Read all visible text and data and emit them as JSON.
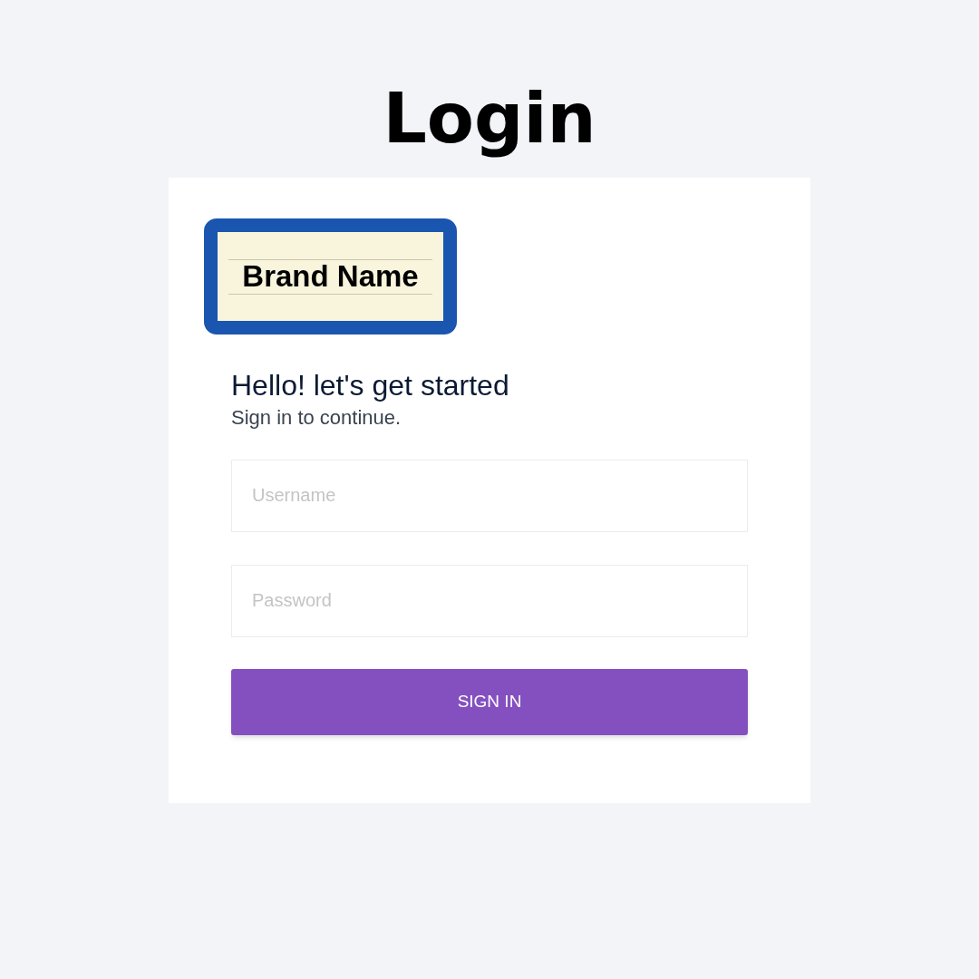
{
  "page_title": "Login",
  "brand": {
    "name": "Brand Name"
  },
  "form": {
    "heading": "Hello! let's get started",
    "subheading": "Sign in to continue.",
    "fields": [
      {
        "placeholder": "Username"
      },
      {
        "placeholder": "Password"
      }
    ],
    "submit": "SIGN IN"
  }
}
